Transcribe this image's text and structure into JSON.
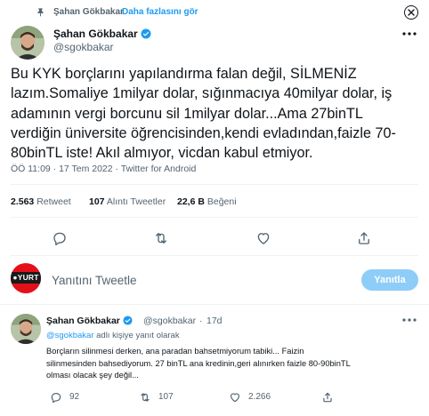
{
  "top_bar": {
    "retweeter": "Şahan Gökbakar",
    "see_more": "Daha fazlasını gör",
    "close_icon": "close-icon"
  },
  "tweet": {
    "author_name": "Şahan Gökbakar",
    "author_handle": "@sgokbakar",
    "text_lines": [
      "Bu KYK borçlarını yapılandırma falan değil, SİLMENİZ",
      "lazım.Somaliye 1milyar dolar, sığınmacıya 40milyar dolar, iş",
      "adamının vergi borcunu sil 1milyar dolar...Ama 27binTL",
      "verdiğin üniversite öğrencisinden,kendi evladından,faizle 70-",
      "80binTL iste! Akıl almıyor, vicdan kabul etmiyor."
    ],
    "meta": "ÖÖ 11:09 · 17 Tem 2022 · Twitter for Android",
    "stats": {
      "retweets_count": "2.563",
      "retweets_label": "Retweet",
      "quotes_count": "107",
      "quotes_label": "Alıntı Tweetler",
      "likes_count": "22,6 B",
      "likes_label": "Beğeni"
    },
    "actions": [
      "reply-icon",
      "retweet-icon",
      "like-icon",
      "share-icon"
    ]
  },
  "reply_box": {
    "avatar_text": "●YURT",
    "placeholder": "Yanıtını Tweetle",
    "button_label": "Yanıtla"
  },
  "reply_tweet": {
    "author_name": "Şahan Gökbakar",
    "author_handle": "@sgokbakar",
    "separator": "·",
    "time": "17d",
    "replying_to_mention": "@sgokbakar",
    "replying_to_suffix": " adlı kişiye yanıt olarak",
    "text_lines": [
      "Borçların silinmesi derken, ana paradan bahsetmiyorum tabiki... Faizin",
      "silinmesinden bahsediyorum. 27 binTL ana kredinin,geri alınırken faizle 80-90binTL",
      "olması olacak şey değil..."
    ],
    "reply_count": "92",
    "retweet_count": "107",
    "like_count": "2.266"
  },
  "colors": {
    "accent": "#1d9bf0",
    "text_primary": "#0f1419",
    "text_secondary": "#536471",
    "divider": "#eff3f4",
    "reply_button_disabled": "#8ecdf8",
    "yurt_red": "#e3101a"
  }
}
